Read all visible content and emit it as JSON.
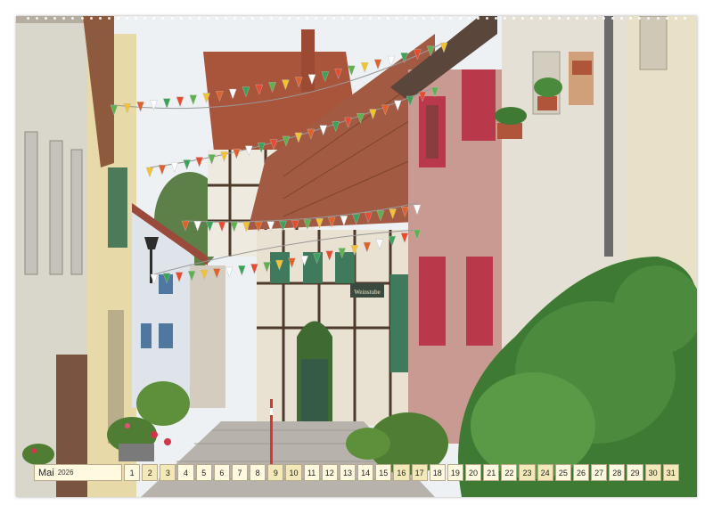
{
  "calendar": {
    "month": "Mai",
    "year": "2026",
    "days": [
      {
        "n": "1",
        "we": false
      },
      {
        "n": "2",
        "we": true
      },
      {
        "n": "3",
        "we": true
      },
      {
        "n": "4",
        "we": false
      },
      {
        "n": "5",
        "we": false
      },
      {
        "n": "6",
        "we": false
      },
      {
        "n": "7",
        "we": false
      },
      {
        "n": "8",
        "we": false
      },
      {
        "n": "9",
        "we": true
      },
      {
        "n": "10",
        "we": true
      },
      {
        "n": "11",
        "we": false
      },
      {
        "n": "12",
        "we": false
      },
      {
        "n": "13",
        "we": false
      },
      {
        "n": "14",
        "we": false
      },
      {
        "n": "15",
        "we": false
      },
      {
        "n": "16",
        "we": true
      },
      {
        "n": "17",
        "we": true
      },
      {
        "n": "18",
        "we": false
      },
      {
        "n": "19",
        "we": false
      },
      {
        "n": "20",
        "we": false
      },
      {
        "n": "21",
        "we": false
      },
      {
        "n": "22",
        "we": false
      },
      {
        "n": "23",
        "we": true
      },
      {
        "n": "24",
        "we": true
      },
      {
        "n": "25",
        "we": false
      },
      {
        "n": "26",
        "we": false
      },
      {
        "n": "27",
        "we": false
      },
      {
        "n": "28",
        "we": false
      },
      {
        "n": "29",
        "we": false
      },
      {
        "n": "30",
        "we": true
      },
      {
        "n": "31",
        "we": true
      }
    ]
  },
  "photo": {
    "sign_text": "Weinstube",
    "colors": {
      "sky": "#f2f4f6",
      "roof": "#a5523c",
      "timber": "#4e3a2a",
      "plaster": "#e9e2d3",
      "shutter_green": "#3f7a5c",
      "pink_wall": "#c99a92",
      "foliage": "#3f7a34",
      "cobble": "#b7b3ac"
    }
  }
}
